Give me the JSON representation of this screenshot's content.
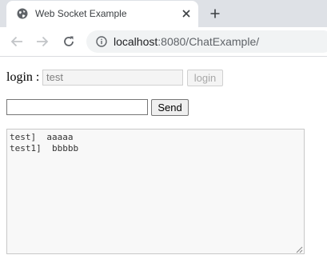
{
  "browser": {
    "tab": {
      "title": "Web Socket Example"
    },
    "address_bar": {
      "host": "localhost",
      "rest": ":8080/ChatExample/"
    },
    "icons": [
      "globe-icon",
      "close-icon",
      "plus-icon",
      "back-arrow-icon",
      "forward-arrow-icon",
      "reload-icon",
      "info-icon"
    ]
  },
  "page": {
    "login": {
      "label": "login :",
      "value": "test",
      "button_label": "login"
    },
    "message": {
      "value": "",
      "send_label": "Send"
    },
    "chat_log": [
      "test]  aaaaa",
      "test1]  bbbbb"
    ]
  }
}
